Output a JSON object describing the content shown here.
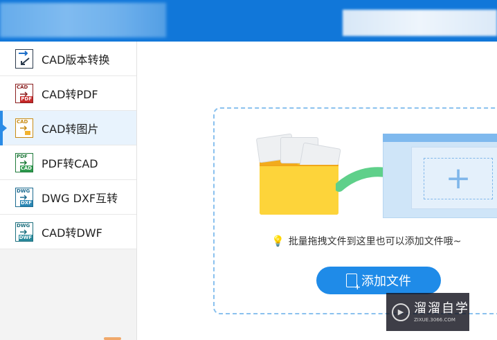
{
  "sidebar": {
    "items": [
      {
        "label": "CAD版本转换",
        "icon": "cad-version-convert-icon",
        "tag_top": "",
        "tag_bottom": ""
      },
      {
        "label": "CAD转PDF",
        "icon": "cad-to-pdf-icon",
        "tag_top": "CAD",
        "tag_bottom": "PDF"
      },
      {
        "label": "CAD转图片",
        "icon": "cad-to-image-icon",
        "tag_top": "CAD",
        "tag_bottom": ""
      },
      {
        "label": "PDF转CAD",
        "icon": "pdf-to-cad-icon",
        "tag_top": "PDF",
        "tag_bottom": "CAD"
      },
      {
        "label": "DWG DXF互转",
        "icon": "dwg-dxf-convert-icon",
        "tag_top": "DWG",
        "tag_bottom": "DXF"
      },
      {
        "label": "CAD转DWF",
        "icon": "cad-to-dwf-icon",
        "tag_top": "DWG",
        "tag_bottom": "DWF"
      }
    ],
    "active_index": 2
  },
  "main": {
    "hint": "批量拖拽文件到这里也可以添加文件哦~",
    "add_button": "添加文件"
  },
  "watermark": {
    "name": "溜溜自学",
    "url": "ZIXUE.3066.COM"
  },
  "colors": {
    "header": "#1177d9",
    "accent": "#1f8be8",
    "folder": "#fdd43a",
    "arrow": "#5fd08a"
  }
}
